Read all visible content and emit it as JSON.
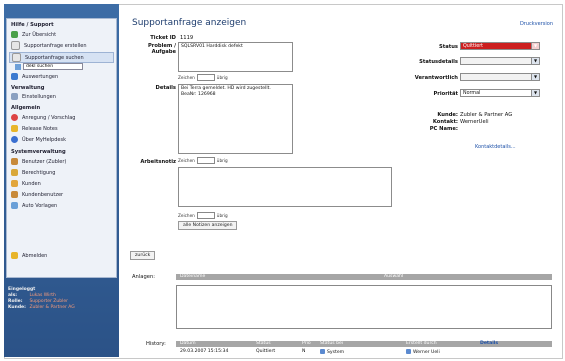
{
  "sidebar": {
    "section_hilfe": "Hilfe / Support",
    "items_hilfe": [
      {
        "label": "Zur Übersicht",
        "icon": "arrow-left-icon"
      },
      {
        "label": "Supportanfrage erstellen",
        "icon": "new-ticket-icon"
      },
      {
        "label": "Supportanfrage suchen",
        "icon": "search-icon"
      }
    ],
    "search_value": "dekl suchen",
    "items_hilfe2": [
      {
        "label": "Auswertungen",
        "icon": "chart-icon"
      }
    ],
    "section_verwaltung": "Verwaltung",
    "items_verwaltung": [
      {
        "label": "Einstellungen",
        "icon": "settings-icon"
      }
    ],
    "section_allgemein": "Allgemein",
    "items_allgemein": [
      {
        "label": "Anregung / Vorschlag",
        "icon": "idea-icon"
      },
      {
        "label": "Release Notes",
        "icon": "star-icon"
      },
      {
        "label": "Über MyHelpdesk",
        "icon": "info-icon"
      }
    ],
    "section_system": "Systemverwaltung",
    "items_system": [
      {
        "label": "Benutzer (Zubler)",
        "icon": "users-icon"
      },
      {
        "label": "Berechtigung",
        "icon": "key-icon"
      },
      {
        "label": "Kunden",
        "icon": "customer-icon"
      },
      {
        "label": "Kundenbenutzer",
        "icon": "customer-users-icon"
      },
      {
        "label": "Auto Vorlagen",
        "icon": "template-icon"
      }
    ],
    "logout": "Abmelden",
    "status": {
      "logged_label": "Eingeloggt als:",
      "logged_value": "Lukas Wirth",
      "role_label": "Rolle:",
      "role_value": "Supporter Zubler",
      "customer_label": "Kunde:",
      "customer_value": "Zubler & Partner AG"
    }
  },
  "page": {
    "title": "Supportanfrage anzeigen",
    "print_link": "Druckversion",
    "ticket_label": "Ticket ID",
    "ticket_value": "1119",
    "problem_label": "Problem / Aufgabe",
    "problem_value": "SQLSRV01 Harddisk defekt",
    "details_label": "Details",
    "details_value": "Bei Terra gemeldet. HD wird zugestellt.\nBeaNr: 126968",
    "note_label": "Arbeitsnotiz",
    "note_value": "",
    "counter_label": "Zeichen",
    "counter_suffix": "übrig",
    "show_notes_button": "alle Notizen anzeigen",
    "back_button": "zurück",
    "status_label": "Status",
    "status_value": "Quittiert",
    "statusdetails_label": "Statusdetails",
    "statusdetails_value": "",
    "responsible_label": "Verantwortlich",
    "responsible_value": "",
    "priority_label": "Priorität",
    "priority_value": "Normal",
    "customer_label": "Kunde:",
    "customer_value": "Zubler & Partner AG",
    "contact_label": "Kontakt:",
    "contact_value": "WernerUeli",
    "pc_label": "PC Name:",
    "pc_value": "",
    "contact_details_link": "Kontaktdetails..."
  },
  "attachments": {
    "label": "Anlagen:",
    "columns": [
      "Dateiname",
      "Auswahl"
    ]
  },
  "history": {
    "label": "History:",
    "columns": [
      "Datum",
      "Status",
      "Prio",
      "Status bei",
      "Erstellt durch",
      "Details"
    ],
    "rows": [
      {
        "date": "29.03.2007 15:15:34",
        "status": "Quittiert",
        "prio": "N",
        "status_at": "System",
        "created_by": "Werner Ueli"
      }
    ]
  },
  "colors": {
    "accent": "#1e3d6e",
    "sidebar": "#3d6da6",
    "status_red": "#cc1f1f"
  }
}
